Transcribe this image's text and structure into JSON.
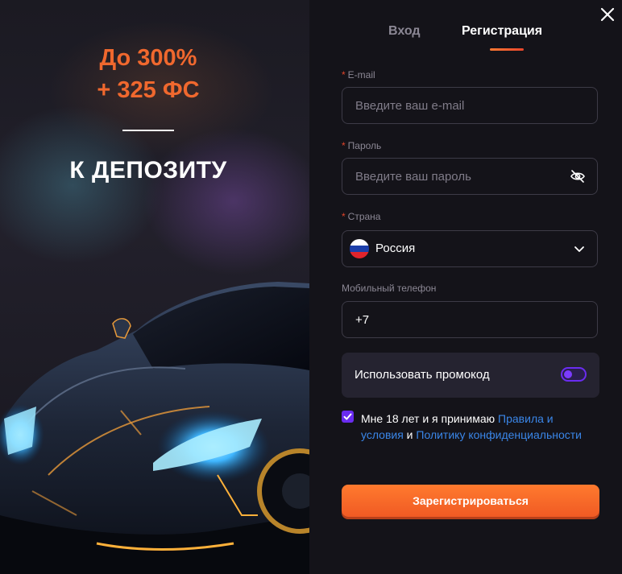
{
  "promo": {
    "amount_line1": "До 300%",
    "amount_line2": "+ 325 ФС",
    "deposit_text": "К ДЕПОЗИТУ"
  },
  "tabs": {
    "login": "Вход",
    "register": "Регистрация",
    "active": "register"
  },
  "form": {
    "email": {
      "label": "E-mail",
      "required": true,
      "placeholder": "Введите ваш e-mail",
      "value": ""
    },
    "password": {
      "label": "Пароль",
      "required": true,
      "placeholder": "Введите ваш пароль",
      "value": ""
    },
    "country": {
      "label": "Страна",
      "required": true,
      "value": "Россия",
      "flag": "russia-flag"
    },
    "phone": {
      "label": "Мобильный телефон",
      "required": false,
      "value": "+7"
    },
    "promocode": {
      "label": "Использовать промокод",
      "enabled": false
    },
    "consent": {
      "checked": true,
      "text_before": "Мне 18 лет и я принимаю ",
      "rules_link": "Правила и условия",
      "text_middle": " и ",
      "privacy_link": "Политику конфиденциальности"
    },
    "submit_label": "Зарегистрироваться"
  },
  "icons": {
    "close": "close-icon",
    "password_visibility": "eye-off-icon",
    "country_dropdown": "chevron-down-icon",
    "consent_checkbox": "checkmark-icon"
  },
  "colors": {
    "accent_orange": "#f0682e",
    "accent_purple": "#6a2cf0",
    "link_blue": "#3a86e8",
    "background": "#141319"
  }
}
